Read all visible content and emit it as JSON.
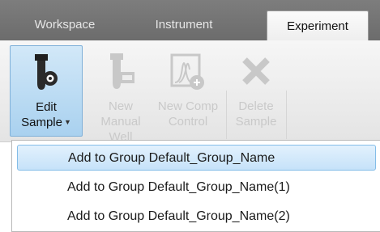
{
  "tabs": [
    {
      "label": "Workspace",
      "active": false
    },
    {
      "label": "Instrument",
      "active": false
    },
    {
      "label": "Experiment",
      "active": true
    }
  ],
  "ribbon": {
    "buttons": [
      {
        "line1": "Edit",
        "line2": "Sample",
        "icon": "tube-edit-icon",
        "enabled": true,
        "has_dropdown": true
      },
      {
        "line1": "New Manual",
        "line2": "Well",
        "icon": "tube-manual-icon",
        "enabled": false
      },
      {
        "line1": "New Comp",
        "line2": "Control",
        "icon": "comp-control-icon",
        "enabled": false
      },
      {
        "line1": "Delete",
        "line2": "Sample",
        "icon": "delete-x-icon",
        "enabled": false
      }
    ]
  },
  "dropdown_menu": {
    "items": [
      {
        "label": "Add to Group Default_Group_Name",
        "highlighted": true
      },
      {
        "label": "Add to Group Default_Group_Name(1)",
        "highlighted": false
      },
      {
        "label": "Add to Group Default_Group_Name(2)",
        "highlighted": false
      }
    ]
  },
  "colors": {
    "tabbar_bg": "#737373",
    "selected_button_bg": "#b9dbf3",
    "menu_highlight": "#cfe6fa",
    "disabled_text": "#c9c9c9"
  }
}
